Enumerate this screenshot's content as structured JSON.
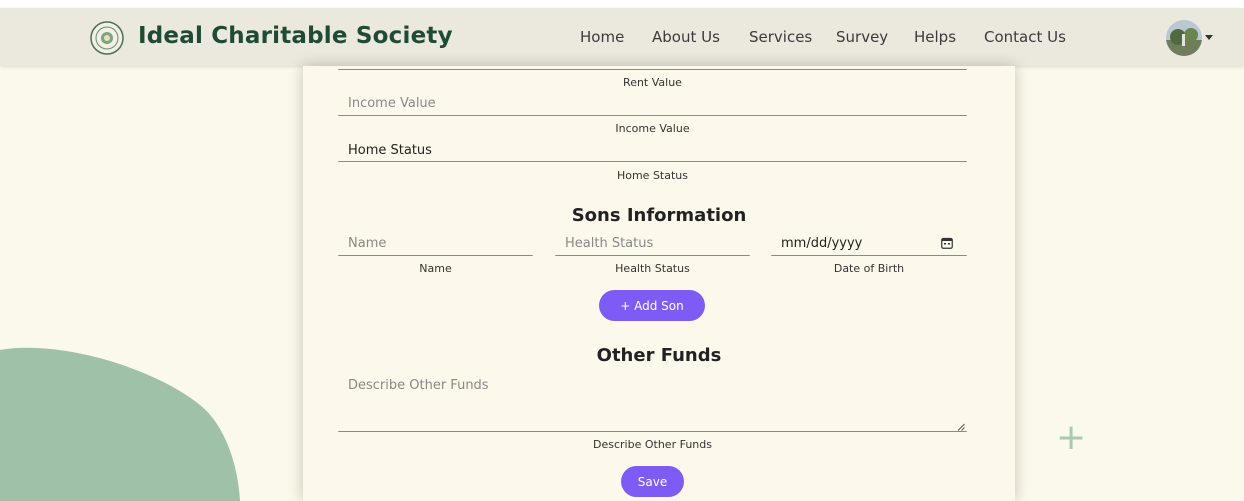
{
  "brand": {
    "name": "Ideal Charitable Society"
  },
  "nav": {
    "items": [
      {
        "label": "Home"
      },
      {
        "label": "About Us"
      },
      {
        "label": "Services"
      },
      {
        "label": "Survey"
      },
      {
        "label": "Helps"
      },
      {
        "label": "Contact Us"
      }
    ]
  },
  "form": {
    "rent": {
      "helper": "Rent Value"
    },
    "income": {
      "placeholder": "Income Value",
      "helper": "Income Value"
    },
    "home": {
      "value": "Home Status",
      "helper": "Home Status"
    },
    "sons": {
      "title": "Sons Information",
      "name": {
        "placeholder": "Name",
        "helper": "Name"
      },
      "health": {
        "placeholder": "Health Status",
        "helper": "Health Status"
      },
      "dob": {
        "value": "mm/dd/yyyy",
        "helper": "Date of Birth"
      },
      "add_button": "+ Add Son"
    },
    "other": {
      "title": "Other Funds",
      "placeholder": "Describe Other Funds",
      "helper": "Describe Other Funds"
    },
    "save_button": "Save"
  },
  "colors": {
    "accent": "#7c5cf5",
    "brand": "#1f4a33",
    "navbar_bg": "#ebe8de",
    "page_bg": "#fbf8ec",
    "blob": "#9fc1a8"
  },
  "icons": [
    "society-logo-icon",
    "calendar-icon",
    "resize-handle-icon",
    "plus-decoration-icon",
    "user-avatar",
    "caret-down-icon"
  ]
}
